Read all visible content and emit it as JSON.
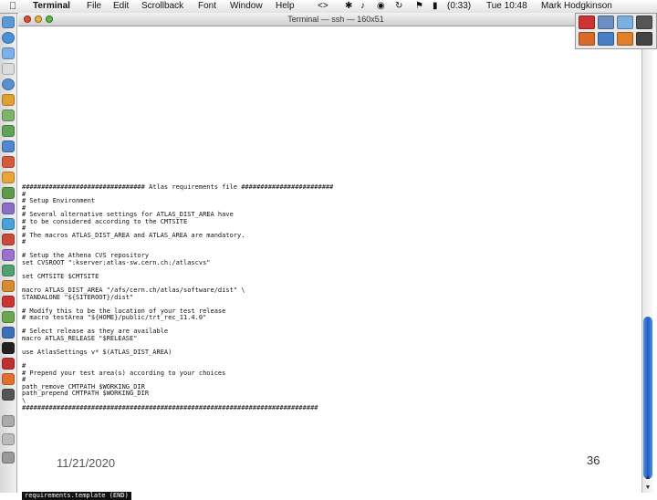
{
  "menubar": {
    "app_name": "Terminal",
    "menus": [
      "File",
      "Edit",
      "Scrollback",
      "Font",
      "Window",
      "Help"
    ],
    "status_icons": [
      "bluetooth-icon",
      "volume-icon",
      "wifi-icon",
      "sync-icon",
      "flag-icon",
      "battery-icon"
    ],
    "battery": "(0:33)",
    "clock": "Tue 10:48",
    "user": "Mark Hodgkinson"
  },
  "window": {
    "title": "Terminal — ssh — 160x51",
    "terminal_lines": [
      "################################ Atlas requirements file ########################",
      "#",
      "# Setup Environment",
      "#",
      "# Several alternative settings for ATLAS_DIST_AREA have",
      "# to be considered according to the CMTSITE",
      "#",
      "# The macros ATLAS_DIST_AREA and ATLAS_AREA are mandatory.",
      "#",
      "",
      "# Setup the Athena CVS repository",
      "set CVSROOT \":kserver:atlas-sw.cern.ch:/atlascvs\"",
      "",
      "set CMTSITE $CMTSITE",
      "",
      "macro ATLAS_DIST_AREA \"/afs/cern.ch/atlas/software/dist\" \\",
      "STANDALONE \"${SITEROOT}/dist\"",
      "",
      "# Modify this to be the location of your test release",
      "# macro testArea \"${HOME}/public/trt_rec_11.4.0\"",
      "",
      "# Select release as they are available",
      "macro ATLAS_RELEASE \"$RELEASE\"",
      "",
      "use AtlasSettings v* $(ATLAS_DIST_AREA)",
      "",
      "#",
      "# Prepend your test area(s) according to your choices",
      "#",
      "path_remove CMTPATH $WORKING_DIR",
      "path_prepend CMTPATH $WORKING_DIR",
      "\\",
      "#############################################################################"
    ],
    "status_line": "requirements.template (END)"
  },
  "slide": {
    "date": "11/21/2020",
    "page_number": "36"
  },
  "dock_icons": [
    "finder-icon",
    "safari-icon",
    "mail-icon",
    "ical-icon",
    "itunes-icon",
    "iphoto-icon",
    "textedit-icon",
    "terminal-icon",
    "preview-icon",
    "system-preferences-icon"
  ],
  "palette_icons": [
    "x11-icon",
    "face-icon",
    "mail-icon",
    "firefox-icon",
    "camera-icon",
    "tool-icon",
    "app-icon",
    "app-icon-2"
  ]
}
